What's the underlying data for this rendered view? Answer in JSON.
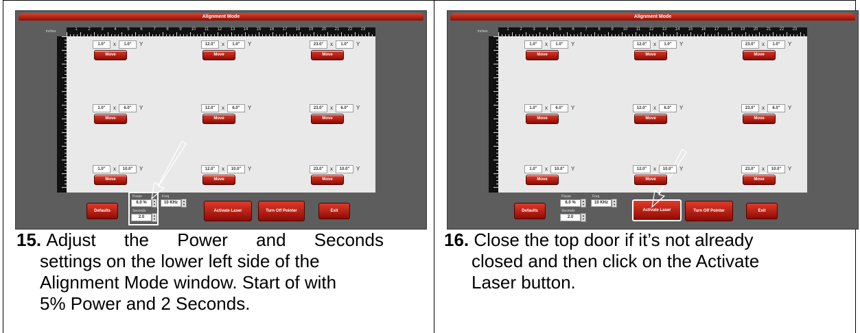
{
  "window_title": "Alignment Mode",
  "ruler": {
    "unit": "inches",
    "numbers": [
      "1",
      "2",
      "3",
      "4",
      "5",
      "6",
      "7",
      "8",
      "9",
      "10",
      "11",
      "12",
      "13",
      "14",
      "15",
      "16",
      "17",
      "18",
      "19",
      "20",
      "21",
      "22",
      "23"
    ]
  },
  "coords": [
    {
      "x": "1.0\"",
      "y": "1.0\""
    },
    {
      "x": "12.0\"",
      "y": "1.0\""
    },
    {
      "x": "23.0\"",
      "y": "1.0\""
    },
    {
      "x": "1.0\"",
      "y": "6.0\""
    },
    {
      "x": "12.0\"",
      "y": "6.0\""
    },
    {
      "x": "23.0\"",
      "y": "6.0\""
    },
    {
      "x": "1.0\"",
      "y": "10.0\""
    },
    {
      "x": "12.0\"",
      "y": "10.0\""
    },
    {
      "x": "23.0\"",
      "y": "10.0\""
    }
  ],
  "labels": {
    "x": "x",
    "y": "Y",
    "move": "Move"
  },
  "controls": {
    "defaults": "Defaults",
    "power_label": "Power",
    "power_value": "6.0 %",
    "seconds_label": "Seconds",
    "seconds_value": "2.0",
    "freq_label": "Freq",
    "freq_value": "10 KHz",
    "activate": "Activate Laser",
    "pointer": "Turn Off Pointer",
    "exit": "Exit"
  },
  "steps": [
    {
      "number": "15.",
      "lines": [
        "Adjust the Power and Seconds",
        "settings on the lower left side of the",
        "Alignment Mode window. Start of with",
        "5% Power and 2 Seconds."
      ]
    },
    {
      "number": "16.",
      "lines": [
        "Close the top door if it’s not already",
        "closed and then click on the Activate",
        "Laser button."
      ]
    }
  ]
}
